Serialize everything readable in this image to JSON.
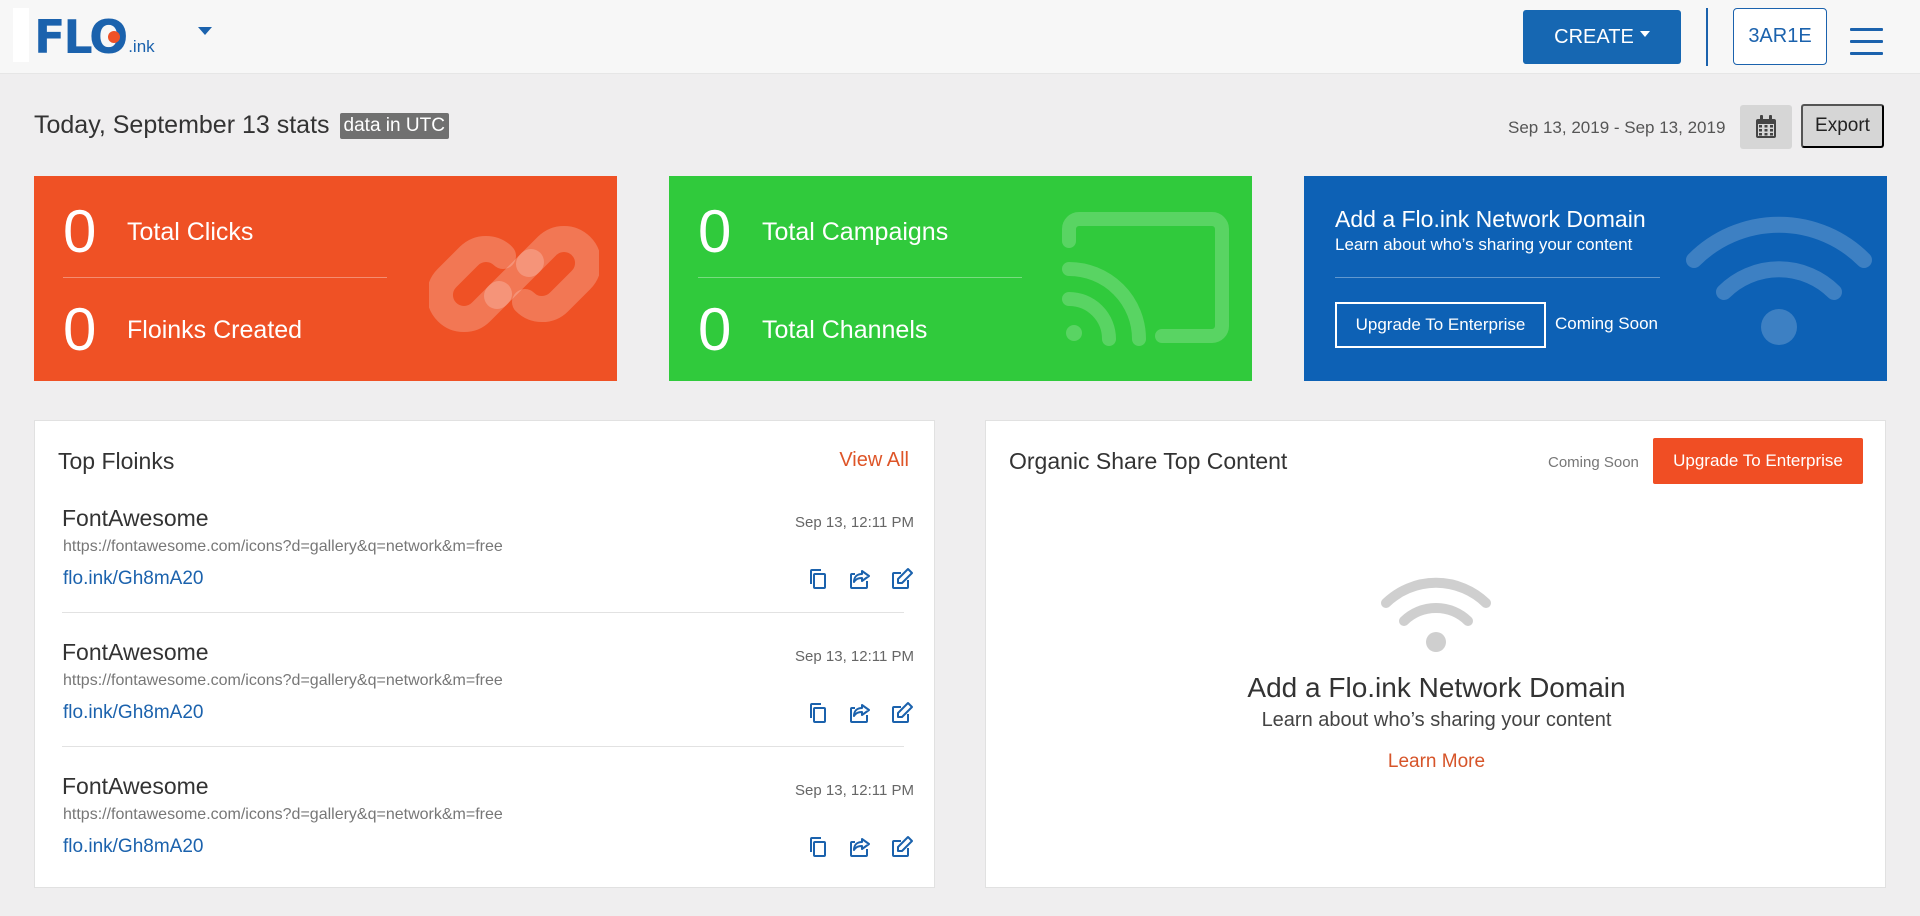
{
  "header": {
    "logo_main": "FLO",
    "logo_sub": ".ink",
    "create_label": "CREATE",
    "user_label": "3AR1E"
  },
  "stats": {
    "title": "Today, September 13 stats",
    "utc_badge": "data in UTC",
    "date_range": "Sep 13, 2019 - Sep 13, 2019",
    "export_label": "Export"
  },
  "cards": {
    "clicks": {
      "value": "0",
      "label": "Total Clicks"
    },
    "floinks": {
      "value": "0",
      "label": "Floinks Created"
    },
    "campaigns": {
      "value": "0",
      "label": "Total Campaigns"
    },
    "channels": {
      "value": "0",
      "label": "Total Channels"
    },
    "network": {
      "title": "Add a Flo.ink Network Domain",
      "subtitle": "Learn about who’s sharing your content",
      "button": "Upgrade To Enterprise",
      "coming_soon": "Coming Soon"
    }
  },
  "top_floinks": {
    "title": "Top Floinks",
    "view_all": "View All",
    "items": [
      {
        "name": "FontAwesome",
        "url": "https://fontawesome.com/icons?d=gallery&q=network&m=free",
        "short": "flo.ink/Gh8mA20",
        "time": "Sep 13, 12:11 PM"
      },
      {
        "name": "FontAwesome",
        "url": "https://fontawesome.com/icons?d=gallery&q=network&m=free",
        "short": "flo.ink/Gh8mA20",
        "time": "Sep 13, 12:11 PM"
      },
      {
        "name": "FontAwesome",
        "url": "https://fontawesome.com/icons?d=gallery&q=network&m=free",
        "short": "flo.ink/Gh8mA20",
        "time": "Sep 13, 12:11 PM"
      }
    ]
  },
  "organic": {
    "title": "Organic Share Top Content",
    "coming_soon": "Coming Soon",
    "upgrade_button": "Upgrade To Enterprise",
    "empty_title": "Add a Flo.ink Network Domain",
    "empty_subtitle": "Learn about who’s sharing your content",
    "learn_more": "Learn More"
  },
  "colors": {
    "brand_blue": "#1b62ad",
    "orange": "#ef5125",
    "green": "#30ca3c",
    "blue_card": "#0d61b5",
    "link_orange": "#de5528"
  }
}
